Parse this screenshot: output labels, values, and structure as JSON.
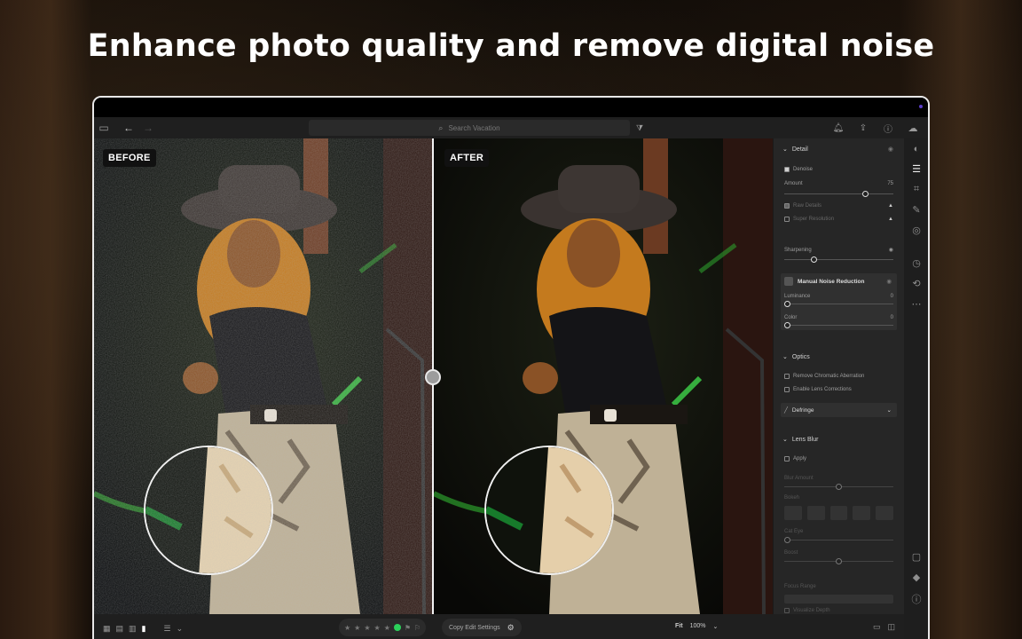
{
  "headline": "Enhance photo quality and remove digital noise",
  "search": {
    "placeholder": "Search Vacation"
  },
  "compare": {
    "before_label": "BEFORE",
    "after_label": "AFTER"
  },
  "panel": {
    "detail": {
      "title": "Detail",
      "denoise": "Denoise",
      "amount_label": "Amount",
      "amount_value": "75",
      "raw_details": "Raw Details",
      "super_resolution": "Super Resolution",
      "sharpening": "Sharpening",
      "manual_noise": "Manual Noise Reduction",
      "luminance": "Luminance",
      "luminance_value": "0",
      "color": "Color",
      "color_value": "0"
    },
    "optics": {
      "title": "Optics",
      "chromatic": "Remove Chromatic Aberration",
      "lens_corrections": "Enable Lens Corrections",
      "defringe": "Defringe"
    },
    "lens_blur": {
      "title": "Lens Blur",
      "apply": "Apply",
      "blur_amount": "Blur Amount",
      "bokeh": "Bokeh",
      "cat_eye": "Cat Eye",
      "boost": "Boost",
      "focus_range": "Focus Range",
      "visualize_depth": "Visualize Depth"
    }
  },
  "bottom": {
    "copy_edit": "Copy Edit Settings",
    "fit": "Fit",
    "zoom": "100%"
  },
  "colors": {
    "accent": "#2bd15a",
    "panel": "#262626",
    "frame": "#e8e8e8"
  }
}
